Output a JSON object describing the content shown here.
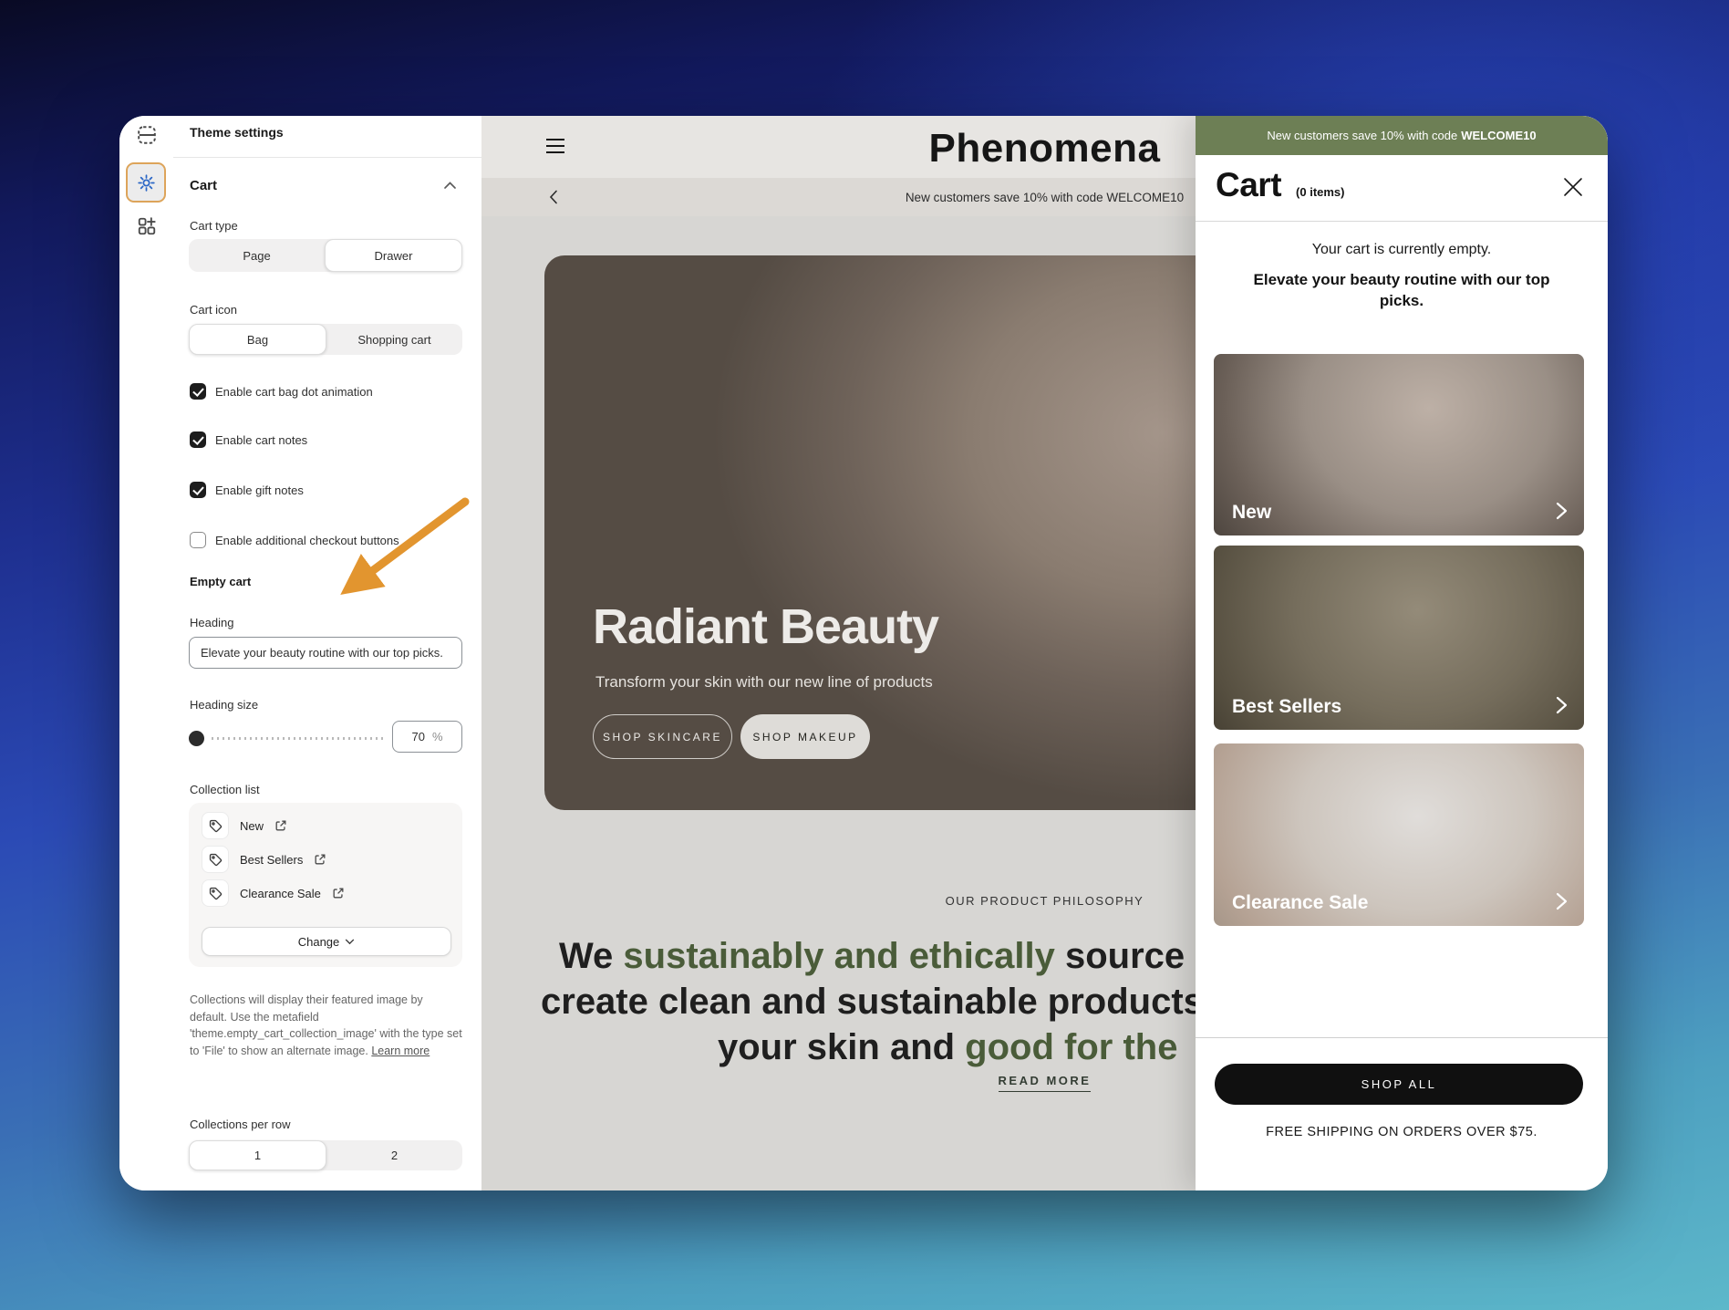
{
  "editor": {
    "panel_title": "Theme settings",
    "cart_section": {
      "title": "Cart",
      "cart_type": {
        "label": "Cart type",
        "options": [
          "Page",
          "Drawer"
        ],
        "selected": "Drawer"
      },
      "cart_icon": {
        "label": "Cart icon",
        "options": [
          "Bag",
          "Shopping cart"
        ],
        "selected": "Bag"
      },
      "checkboxes": [
        {
          "label": "Enable cart bag dot animation",
          "checked": true
        },
        {
          "label": "Enable cart notes",
          "checked": true
        },
        {
          "label": "Enable gift notes",
          "checked": true
        },
        {
          "label": "Enable additional checkout buttons",
          "checked": false
        }
      ],
      "empty_cart": {
        "title": "Empty cart",
        "heading_label": "Heading",
        "heading_value": "Elevate your beauty routine with our top picks.",
        "heading_size_label": "Heading size",
        "heading_size_value": "70",
        "heading_size_unit": "%",
        "collection_list": {
          "label": "Collection list",
          "items": [
            {
              "label": "New"
            },
            {
              "label": "Best Sellers"
            },
            {
              "label": "Clearance Sale"
            }
          ],
          "change_button": "Change",
          "help_text": "Collections will display their featured image by default. Use the metafield 'theme.empty_cart_collection_image' with the type set to 'File' to show an alternate image. ",
          "help_link": "Learn more"
        },
        "collections_per_row": {
          "label": "Collections per row",
          "options": [
            "1",
            "2"
          ],
          "selected": "1"
        }
      }
    }
  },
  "storefront": {
    "logo": "Phenomena",
    "announcement": "New customers save 10% with code WELCOME10",
    "hero": {
      "title": "Radiant Beauty",
      "subtitle": "Transform your skin with our new line of products",
      "button_skincare": "SHOP SKINCARE",
      "button_makeup": "SHOP MAKEUP"
    },
    "philosophy": {
      "eyebrow": "OUR PRODUCT PHILOSOPHY",
      "line1_pre": "We ",
      "line1_green": "sustainably and ethically",
      "line1_post": " source",
      "line2": "create clean and sustainable products",
      "line3_pre": "your skin and ",
      "line3_green": "good for the",
      "read_more": "READ MORE"
    }
  },
  "drawer": {
    "announcement_prefix": "New customers save 10% with code",
    "announcement_code": "WELCOME10",
    "title": "Cart",
    "items_count": "(0 items)",
    "empty_message": "Your cart is currently empty.",
    "empty_heading": "Elevate your beauty routine with our top picks.",
    "cards": [
      {
        "label": "New"
      },
      {
        "label": "Best Sellers"
      },
      {
        "label": "Clearance Sale"
      }
    ],
    "shop_all": "SHOP ALL",
    "shipping_note": "FREE SHIPPING ON ORDERS OVER $75."
  },
  "colors": {
    "announcement_green": "#6d7f55",
    "philosophy_green": "#4a5c39",
    "gear_highlight_orange": "#dda45a",
    "annotation_arrow_orange": "#e2952f",
    "gear_blue": "#2a66c5",
    "shop_all_black": "#101010"
  }
}
